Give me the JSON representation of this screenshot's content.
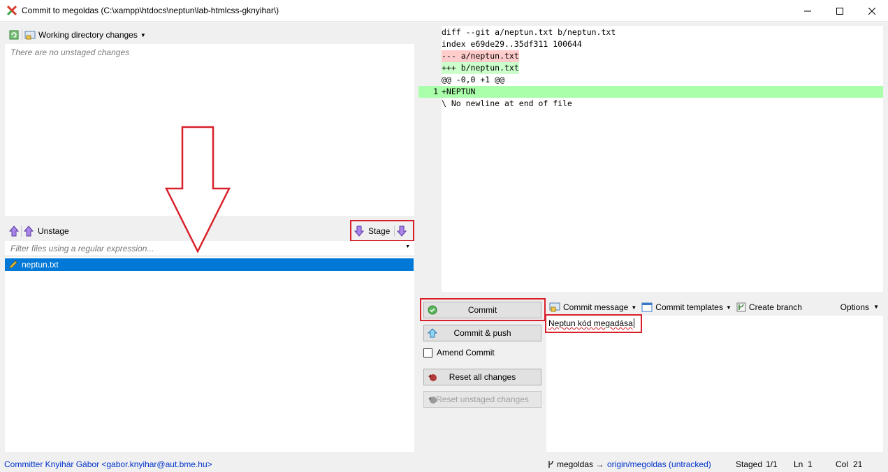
{
  "window": {
    "title": "Commit to megoldas (C:\\xampp\\htdocs\\neptun\\lab-htmlcss-gknyihar\\)"
  },
  "unstaged": {
    "dropdown_label": "Working directory changes",
    "empty_message": "There are no unstaged changes"
  },
  "staged": {
    "unstage_label": "Unstage",
    "stage_label": "Stage",
    "filter_placeholder": "Filter files using a regular expression...",
    "files": [
      {
        "name": "neptun.txt"
      }
    ]
  },
  "diff": {
    "lines": [
      {
        "text": "diff --git a/neptun.txt b/neptun.txt",
        "kind": "header"
      },
      {
        "text": "index e69de29..35df311 100644",
        "kind": "header"
      },
      {
        "text": "--- a/neptun.txt",
        "kind": "removed"
      },
      {
        "text": "+++ b/neptun.txt",
        "kind": "added"
      },
      {
        "text": "@@ -0,0 +1 @@",
        "kind": "header"
      },
      {
        "text": "+NEPTUN",
        "kind": "added-line",
        "line_number": "1"
      },
      {
        "text": "\\ No newline at end of file",
        "kind": "header"
      }
    ]
  },
  "actions": {
    "commit": "Commit",
    "commit_push": "Commit & push",
    "amend": "Amend Commit",
    "reset_all": "Reset all changes",
    "reset_unstaged": "Reset unstaged changes"
  },
  "message_toolbar": {
    "commit_message": "Commit message",
    "commit_templates": "Commit templates",
    "create_branch": "Create branch",
    "options": "Options"
  },
  "message": {
    "text": "Neptun kód megadása"
  },
  "status": {
    "committer": "Committer Knyihár Gábor <gabor.knyihar@aut.bme.hu>",
    "branch": "megoldas →",
    "remote": "origin/megoldas (untracked)",
    "staged_label": "Staged",
    "staged_count": "1/1",
    "ln_label": "Ln",
    "ln_value": "1",
    "col_label": "Col",
    "col_value": "21"
  },
  "colors": {
    "selection": "#0078d7",
    "added_bg": "#ccffcc",
    "removed_bg": "#ffcccc",
    "added_line_bg": "#aaffaa",
    "annotation_red": "#d9202a"
  }
}
